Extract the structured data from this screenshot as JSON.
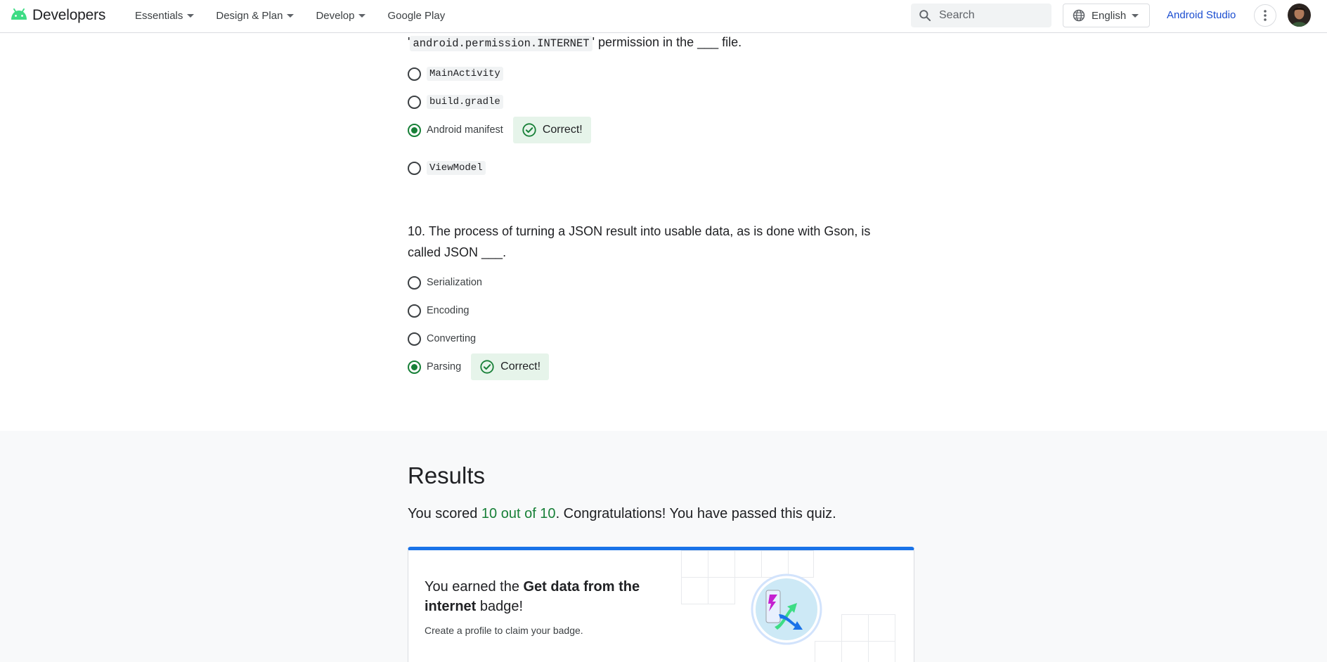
{
  "header": {
    "brand": "Developers",
    "nav": [
      {
        "label": "Essentials",
        "dropdown": true
      },
      {
        "label": "Design & Plan",
        "dropdown": true
      },
      {
        "label": "Develop",
        "dropdown": true
      },
      {
        "label": "Google Play",
        "dropdown": false
      }
    ],
    "search_placeholder": "Search",
    "language": "English",
    "studio_link": "Android Studio"
  },
  "quiz": {
    "q9": {
      "prefix": "'",
      "code": "android.permission.INTERNET",
      "suffix": "' permission in the ___ file.",
      "options": [
        {
          "label": "MainActivity",
          "code": true,
          "checked": false
        },
        {
          "label": "build.gradle",
          "code": true,
          "checked": false
        },
        {
          "label": "Android manifest",
          "code": false,
          "checked": true
        },
        {
          "label": "ViewModel",
          "code": true,
          "checked": false
        }
      ],
      "feedback": "Correct!"
    },
    "q10": {
      "number": "10.",
      "text_line1": "The process of turning a JSON result into usable data, as is done with Gson, is",
      "text_line2": "called JSON ___.",
      "options": [
        {
          "label": "Serialization",
          "checked": false
        },
        {
          "label": "Encoding",
          "checked": false
        },
        {
          "label": "Converting",
          "checked": false
        },
        {
          "label": "Parsing",
          "checked": true
        }
      ],
      "feedback": "Correct!"
    }
  },
  "results": {
    "title": "Results",
    "score_prefix": "You scored ",
    "score": "10 out of 10",
    "score_suffix": ". Congratulations! You have passed this quiz.",
    "badge_prefix": "You earned the ",
    "badge_name": "Get data from the internet",
    "badge_suffix": " badge!",
    "badge_sub": "Create a profile to claim your badge."
  },
  "colors": {
    "accent_blue": "#1a73e8",
    "link_blue": "#1a4dd0",
    "correct_green": "#188038",
    "correct_bg": "#e6f4ea",
    "android_green": "#3ddc84"
  },
  "icons": [
    "android-logo-icon",
    "search-icon",
    "globe-icon",
    "more-vert-icon",
    "check-circle-icon",
    "badge-illustration-icon"
  ]
}
